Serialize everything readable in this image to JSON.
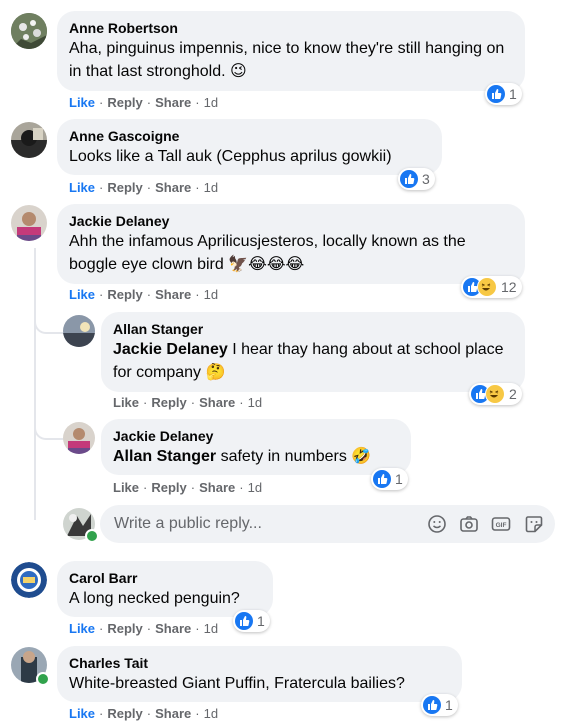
{
  "comments": [
    {
      "name": "Anne Robertson",
      "text": "Aha, pinguinus impennis, nice to know they're still hanging on in that last stronghold. 😉",
      "actions": [
        "Like",
        "Reply",
        "Share"
      ],
      "time": "1d",
      "reactions": "1"
    },
    {
      "name": "Anne Gascoigne",
      "text": "Looks like a Tall auk (Cepphus aprilus gowkii)",
      "actions": [
        "Like",
        "Reply",
        "Share"
      ],
      "time": "1d",
      "reactions": "3"
    },
    {
      "name": "Jackie Delaney",
      "text": "Ahh the infamous Aprilicusjesteros, locally known as the boggle eye clown bird 🦅😂😂😂",
      "actions": [
        "Like",
        "Reply",
        "Share"
      ],
      "time": "1d",
      "reactions": "12"
    },
    {
      "name": "Allan Stanger",
      "mention": "Jackie Delaney",
      "text": " I hear thay hang about at school place for company 🤔",
      "actions": [
        "Like",
        "Reply",
        "Share"
      ],
      "time": "1d",
      "reactions": "2"
    },
    {
      "name": "Jackie Delaney",
      "mention": "Allan Stanger",
      "text": " safety in numbers 🤣",
      "actions": [
        "Like",
        "Reply",
        "Share"
      ],
      "time": "1d",
      "reactions": "1"
    },
    {
      "name": "Carol Barr",
      "text": "A long necked penguin?",
      "actions": [
        "Like",
        "Reply",
        "Share"
      ],
      "time": "1d",
      "reactions": "1"
    },
    {
      "name": "Charles Tait",
      "text": "White-breasted Giant Puffin, Fratercula bailies?",
      "actions": [
        "Like",
        "Reply",
        "Share"
      ],
      "time": "1d",
      "reactions": "1"
    }
  ],
  "reply_input": {
    "placeholder": "Write a public reply..."
  },
  "icons": {
    "emoji": "smiley-icon",
    "camera": "camera-icon",
    "gif": "gif-icon",
    "sticker": "sticker-icon"
  },
  "gif_label": "GIF",
  "colors": {
    "like_blue": "#1877f2",
    "bubble_bg": "#f0f2f5",
    "meta_gray": "#65676b",
    "online_green": "#31a24c"
  }
}
